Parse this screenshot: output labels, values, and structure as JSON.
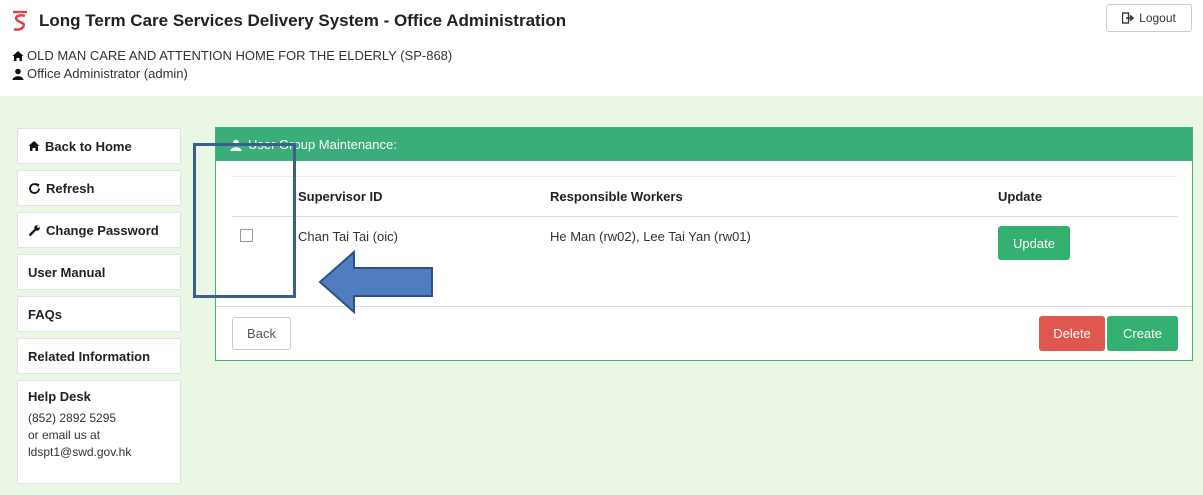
{
  "header": {
    "title": "Long Term Care Services Delivery System - Office Administration",
    "organization": "OLD MAN CARE AND ATTENTION HOME FOR THE ELDERLY (SP-868)",
    "user": "Office Administrator (admin)",
    "logout_label": "Logout",
    "brand_color": "#e0463e"
  },
  "sidebar": {
    "items": [
      {
        "label": "Back to Home",
        "icon": "home-icon"
      },
      {
        "label": "Refresh",
        "icon": "refresh-icon"
      },
      {
        "label": "Change Password",
        "icon": "wrench-icon"
      },
      {
        "label": "User Manual"
      },
      {
        "label": "FAQs"
      },
      {
        "label": "Related Information"
      }
    ],
    "helpdesk": {
      "title": "Help Desk",
      "phone": "(852) 2892 5295",
      "email_prefix": "or email us at",
      "email": "ldspt1@swd.gov.hk"
    }
  },
  "panel": {
    "title": "User Group Maintenance:",
    "header_color": "#3aad7a",
    "columns": [
      "Supervisor ID",
      "Responsible Workers",
      "Update"
    ],
    "rows": [
      {
        "checked": false,
        "supervisor": "Chan Tai Tai (oic)",
        "workers": "He Man (rw02), Lee Tai Yan (rw01)",
        "update_label": "Update"
      }
    ],
    "back_label": "Back",
    "delete_label": "Delete",
    "create_label": "Create"
  }
}
